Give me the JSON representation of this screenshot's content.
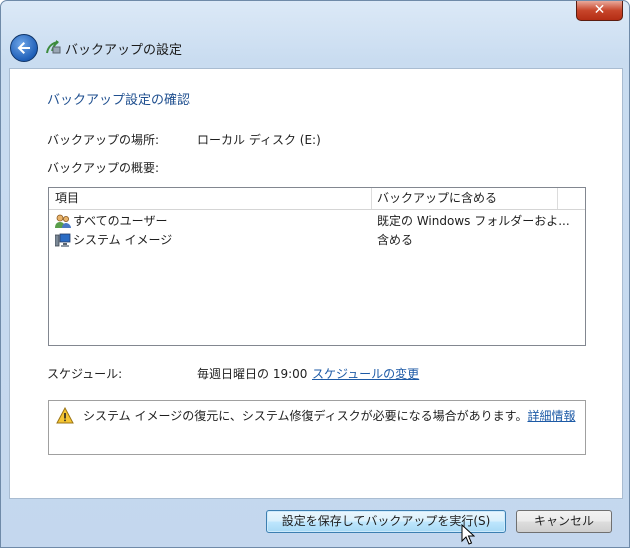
{
  "window": {
    "title": "バックアップの設定",
    "close_glyph": "✕"
  },
  "content": {
    "heading": "バックアップ設定の確認",
    "location_label": "バックアップの場所:",
    "location_value": "ローカル ディスク (E:)",
    "summary_label": "バックアップの概要:",
    "table": {
      "columns": [
        "項目",
        "バックアップに含める"
      ],
      "rows": [
        {
          "icon": "users-icon",
          "item": "すべてのユーザー",
          "value": "既定の Windows フォルダーおよ..."
        },
        {
          "icon": "system-image-icon",
          "item": "システム イメージ",
          "value": "含める"
        }
      ]
    },
    "schedule_label": "スケジュール:",
    "schedule_value": "毎週日曜日の 19:00",
    "schedule_link": "スケジュールの変更",
    "warning_text": "システム イメージの復元に、システム修復ディスクが必要になる場合があります。",
    "warning_link": "詳細情報"
  },
  "buttons": {
    "save_run": "設定を保存してバックアップを実行(S)",
    "cancel": "キャンセル"
  },
  "colors": {
    "heading": "#1f4f8f",
    "link": "#1d5aa6",
    "chrome": "#c4d7ee"
  }
}
